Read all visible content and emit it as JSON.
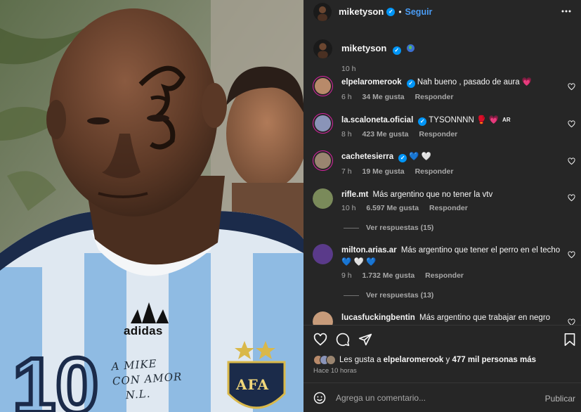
{
  "post": {
    "photo": {
      "brand": "adidas",
      "number": "10",
      "signature": "A MIKE\nCON AMOR\n   N.L.",
      "badge": "AFA"
    },
    "author": "miketyson",
    "follow_label": "Seguir",
    "more_icon": "more-horizontal-icon"
  },
  "caption": {
    "username": "miketyson",
    "time": "10 h"
  },
  "comments": [
    {
      "username": "elpelaromerook",
      "text": "Nah bueno , pasado de aura",
      "emoji": "💗",
      "time": "6 h",
      "likes": "34 Me gusta",
      "reply": "Responder",
      "avatar_color": "#b88a6a"
    },
    {
      "username": "la.scaloneta.oficial",
      "text": "TYSONNNN",
      "emoji": "🥊 💗",
      "tag": "AR",
      "time": "8 h",
      "likes": "423 Me gusta",
      "reply": "Responder",
      "avatar_color": "#8a94b8"
    },
    {
      "username": "cachetesierra",
      "text": "",
      "emoji": "💙 🤍",
      "time": "7 h",
      "likes": "19 Me gusta",
      "reply": "Responder",
      "avatar_color": "#9a8570"
    },
    {
      "username": "rifle.mt",
      "text": "Más argentino que no tener la vtv",
      "time": "10 h",
      "likes": "6.597 Me gusta",
      "reply": "Responder",
      "replies": "Ver respuestas (15)",
      "avatar_color": "#7a8a5a"
    },
    {
      "username": "milton.arias.ar",
      "text": "Más argentino que tener el perro en el techo",
      "line2": "💙 🤍 💙",
      "time": "9 h",
      "likes": "1.732 Me gusta",
      "reply": "Responder",
      "replies": "Ver respuestas (13)",
      "avatar_color": "#5a3a8a"
    },
    {
      "username": "lucasfuckingbentin",
      "text": "Más argentino que trabajar en negro",
      "avatar_color": "#c79b7a"
    }
  ],
  "likes_summary": {
    "prefix": "Les gusta a ",
    "user": "elpelaromerook",
    "middle": " y ",
    "rest": "477 mil personas más"
  },
  "timestamp": "Hace 10 horas",
  "composer": {
    "placeholder": "Agrega un comentario...",
    "publish_label": "Publicar"
  },
  "colors": {
    "panel_bg": "#262626",
    "link_blue": "#4a9cf4",
    "verified_blue": "#0095f6"
  }
}
